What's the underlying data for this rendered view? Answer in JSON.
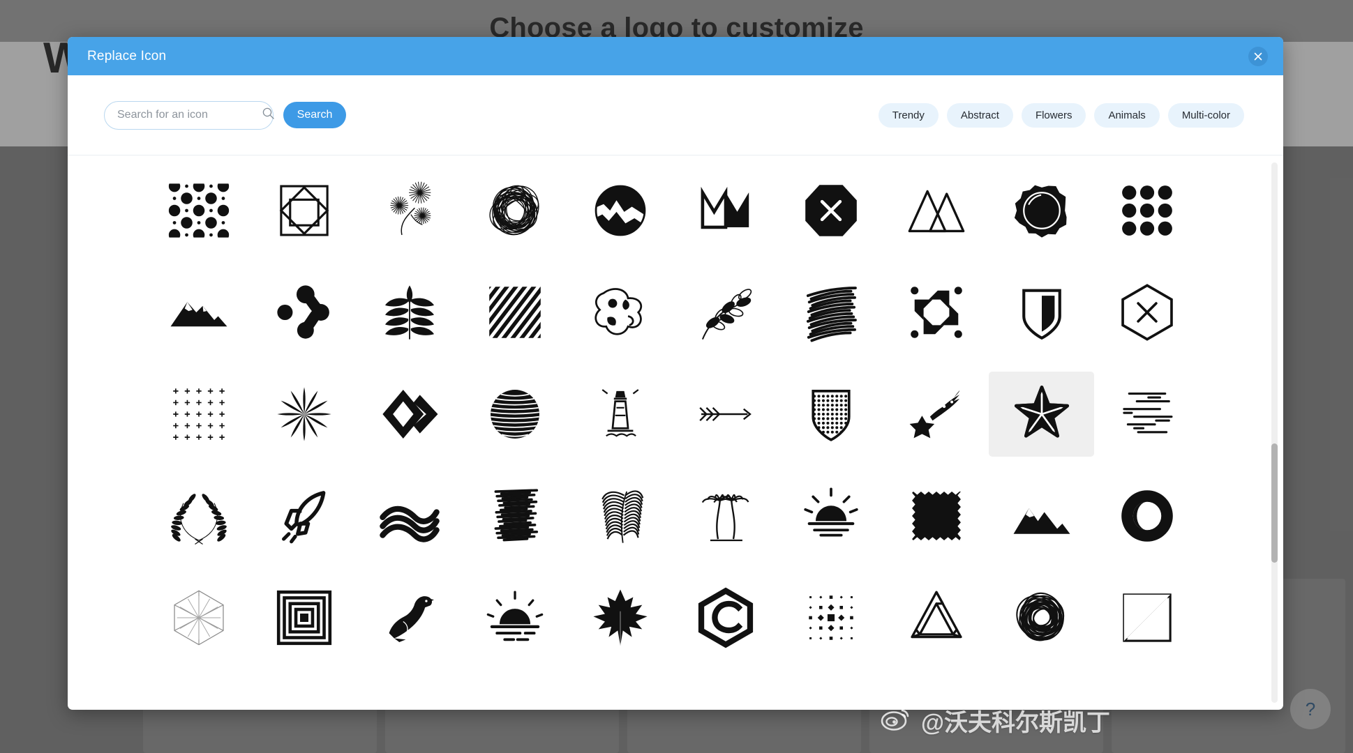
{
  "background": {
    "page_title": "Choose a logo to customize",
    "wordmark": "W"
  },
  "modal": {
    "title": "Replace Icon",
    "close_icon": "close-icon"
  },
  "toolbar": {
    "search": {
      "placeholder": "Search for an icon",
      "value": "",
      "icon": "search-icon"
    },
    "search_button_label": "Search",
    "chips": [
      {
        "label": "Trendy"
      },
      {
        "label": "Abstract"
      },
      {
        "label": "Flowers"
      },
      {
        "label": "Animals"
      },
      {
        "label": "Multi-color"
      }
    ]
  },
  "grid": {
    "selected_index": 28,
    "icons": [
      {
        "name": "dot-pattern-icon"
      },
      {
        "name": "nested-square-diamond-icon"
      },
      {
        "name": "daisy-sprig-icon"
      },
      {
        "name": "scribble-ball-icon"
      },
      {
        "name": "circle-landscape-icon"
      },
      {
        "name": "crown-icon"
      },
      {
        "name": "octagon-cross-icon"
      },
      {
        "name": "double-triangle-mountain-icon"
      },
      {
        "name": "ink-blob-circle-icon"
      },
      {
        "name": "nine-dot-grid-icon"
      },
      {
        "name": "mountain-silhouette-icon"
      },
      {
        "name": "molecule-node-icon"
      },
      {
        "name": "compound-leaf-icon"
      },
      {
        "name": "diagonal-stripes-icon"
      },
      {
        "name": "abstract-blob-doodle-icon"
      },
      {
        "name": "botanical-branch-icon"
      },
      {
        "name": "hatch-scribble-icon"
      },
      {
        "name": "pinwheel-arrows-icon"
      },
      {
        "name": "shield-split-icon"
      },
      {
        "name": "hexagon-cross-icon"
      },
      {
        "name": "plus-grid-icon"
      },
      {
        "name": "starburst-bloom-icon"
      },
      {
        "name": "double-diamond-chevron-icon"
      },
      {
        "name": "striped-sphere-icon"
      },
      {
        "name": "lighthouse-icon"
      },
      {
        "name": "triple-chevron-arrow-icon"
      },
      {
        "name": "dotted-shield-icon"
      },
      {
        "name": "shooting-star-icon"
      },
      {
        "name": "nautical-star-icon"
      },
      {
        "name": "speed-lines-icon"
      },
      {
        "name": "laurel-wreath-icon"
      },
      {
        "name": "rocket-icon"
      },
      {
        "name": "wave-swoosh-icon"
      },
      {
        "name": "brush-scribble-icon"
      },
      {
        "name": "palm-frond-icon"
      },
      {
        "name": "palm-trees-icon"
      },
      {
        "name": "sunburst-horizon-icon"
      },
      {
        "name": "torn-square-block-icon"
      },
      {
        "name": "mountain-range-icon"
      },
      {
        "name": "circle-crescent-icon"
      },
      {
        "name": "hexagon-web-icon"
      },
      {
        "name": "concentric-squares-icon"
      },
      {
        "name": "eagle-icon"
      },
      {
        "name": "sunset-icon"
      },
      {
        "name": "maple-leaf-icon"
      },
      {
        "name": "hexagon-c-monogram-icon"
      },
      {
        "name": "dot-matrix-icon"
      },
      {
        "name": "penrose-triangle-icon"
      },
      {
        "name": "scribble-circle-icon"
      },
      {
        "name": "split-square-icon"
      }
    ]
  },
  "watermark": {
    "handle": "@沃夫科尔斯凯丁",
    "logo_icon": "weibo-icon"
  },
  "help": {
    "label": "?"
  },
  "colors": {
    "header_blue": "#47a3e8",
    "button_blue": "#3d9ae6",
    "chip_bg": "#e8f3fc",
    "selected_cell": "#efefef",
    "icon_black": "#111111"
  }
}
